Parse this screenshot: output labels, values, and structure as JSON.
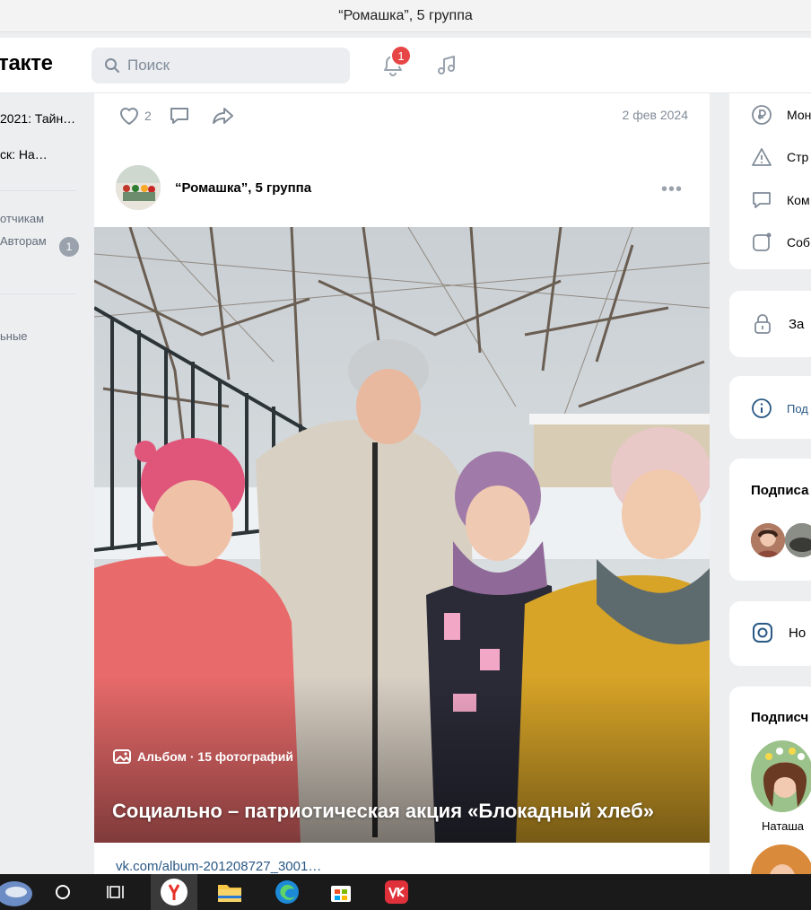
{
  "window": {
    "title": "“Ромашка”, 5 группа"
  },
  "header": {
    "logo_text": "такте",
    "search_placeholder": "Поиск",
    "notifications_count": "1",
    "icons": [
      "search-icon",
      "bell-icon",
      "music-icon"
    ]
  },
  "left_sidebar": {
    "items": [
      {
        "label": "2021: Тайн…"
      },
      {
        "label": "ск: На…",
        "count": "1"
      }
    ],
    "links": [
      "отчикам",
      "Авторам"
    ],
    "bottom_link": "ьные"
  },
  "post_top": {
    "likes": "2",
    "date": "2 фев 2024"
  },
  "post": {
    "group_name": "“Ромашка”, 5 группа",
    "album_meta": "Альбом · 15 фотографий",
    "album_title": "Социально – патриотическая акция «Блокадный хлеб»",
    "link": "vk.com/album-201208727_3001…"
  },
  "right_sidebar": {
    "menu": [
      {
        "label": "Мон",
        "icon": "ruble-icon"
      },
      {
        "label": "Стр",
        "icon": "warning-icon"
      },
      {
        "label": "Ком",
        "icon": "comment-icon"
      },
      {
        "label": "Соб",
        "icon": "event-icon"
      }
    ],
    "lock_label": "За",
    "info_label": "Под",
    "subscriptions_title": "Подписа",
    "instagram_label": "Но",
    "subscribers_title": "Подписч",
    "subscriber_name": "Наташа"
  },
  "taskbar": {
    "icons": [
      "weather-icon",
      "cortana-icon",
      "task-view-icon",
      "yandex-browser-icon",
      "file-explorer-icon",
      "edge-icon",
      "store-icon",
      "vk-app-icon"
    ]
  },
  "colors": {
    "accent": "#2a5885",
    "badge_red": "#e64646",
    "page_bg": "#edeef0",
    "muted": "#818c99"
  }
}
